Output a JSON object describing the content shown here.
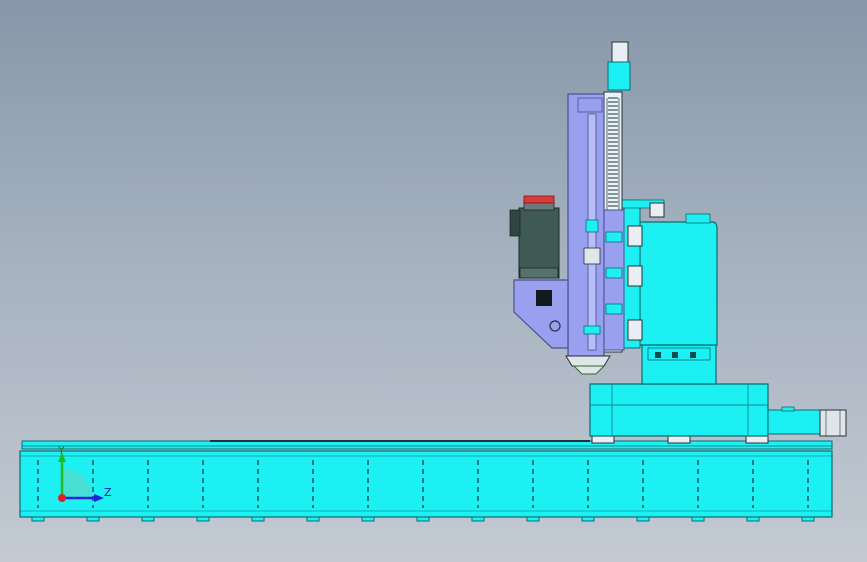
{
  "viewport": {
    "background_top": "#8797a9",
    "background_bottom": "#c3cad3"
  },
  "colors": {
    "bed": "#1cf0f2",
    "bed_edge": "#0b6c72",
    "column": "#9aa0f0",
    "column_edge": "#4b4f8a",
    "servo_motor": "#3f5a55",
    "motor_cap": "#d93a3a",
    "saddle": "#1cf0f2",
    "rail": "#2b2f3a"
  },
  "triad": {
    "y_label": "Y",
    "z_label": "Z",
    "x_color": "#d22",
    "y_color": "#2b2",
    "z_color": "#22d"
  }
}
